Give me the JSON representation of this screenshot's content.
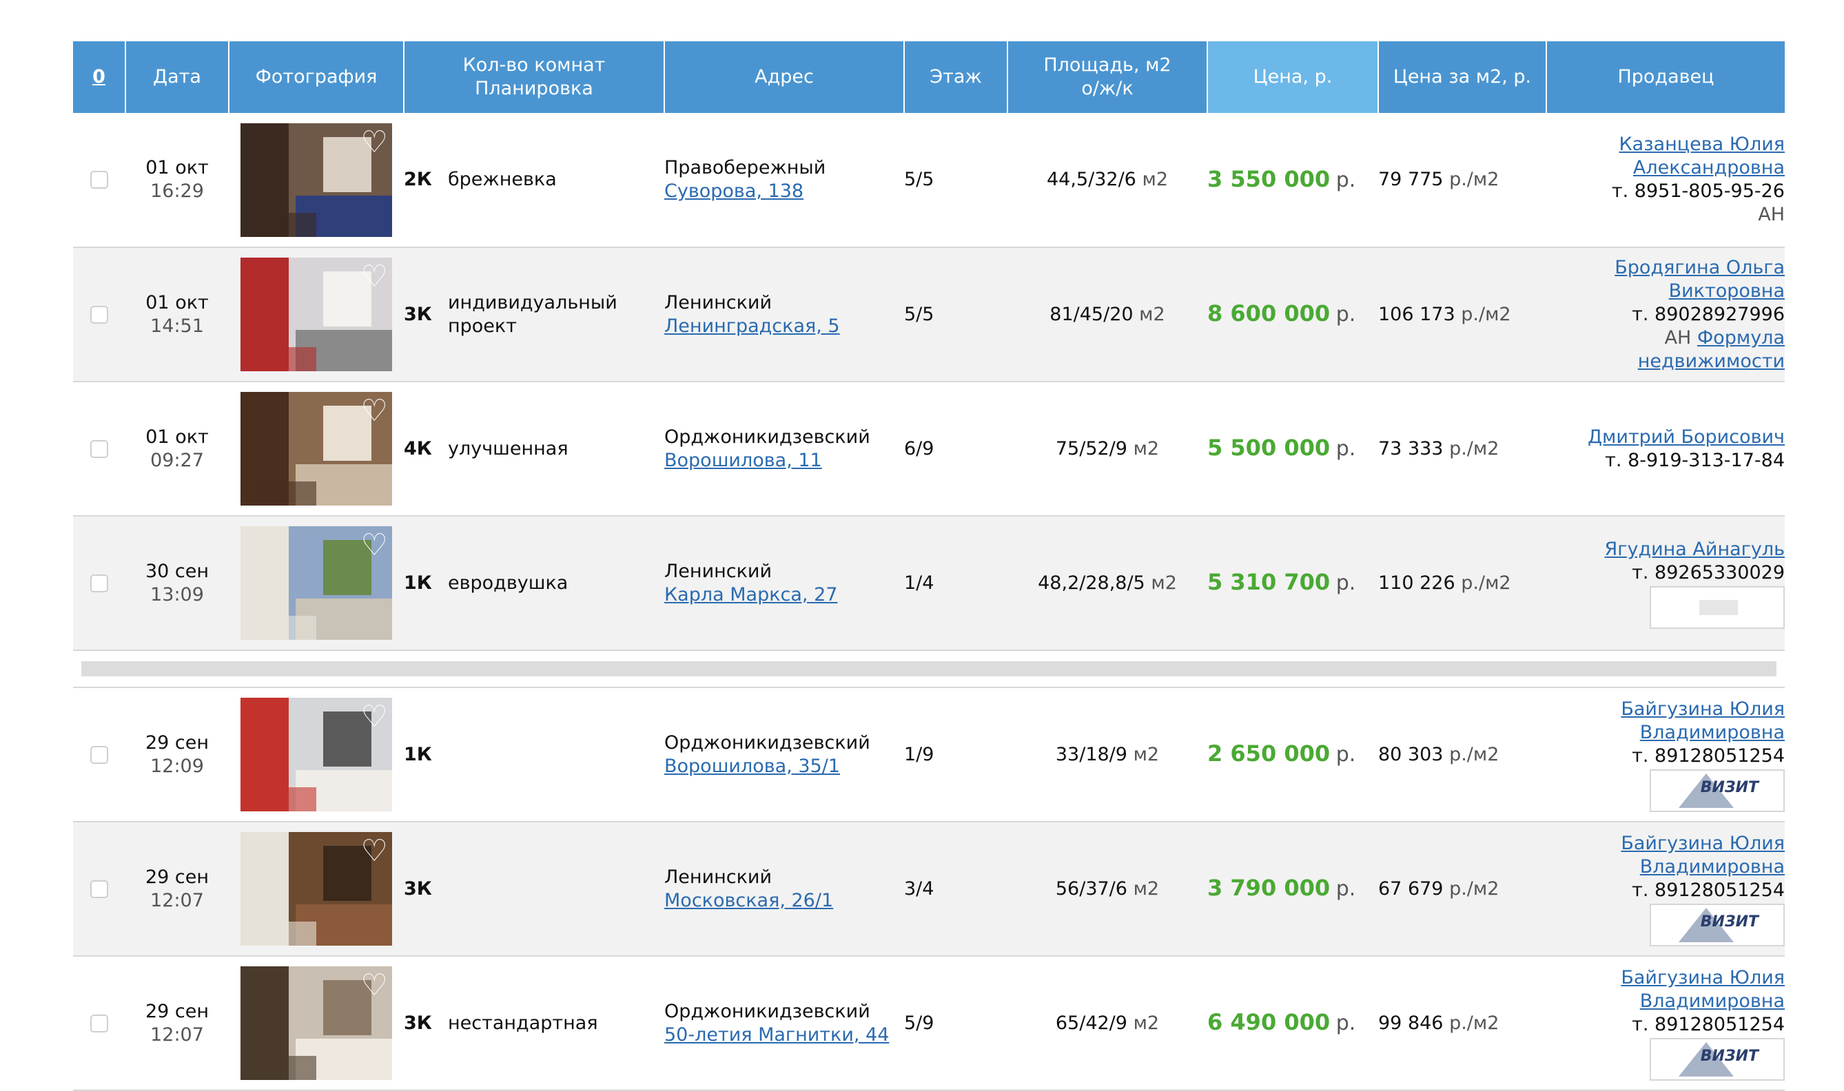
{
  "header": {
    "sort_label": "0",
    "date": "Дата",
    "photo": "Фотография",
    "rooms_line1": "Кол-во комнат",
    "rooms_line2": "Планировка",
    "address": "Адрес",
    "floor": "Этаж",
    "area_line1": "Площадь, м2",
    "area_line2": "о/ж/к",
    "price": "Цена, р.",
    "price_per_m2": "Цена за м2, р.",
    "seller": "Продавец"
  },
  "price_currency": "р.",
  "ppm_unit": "р./м2",
  "area_unit": "м2",
  "listings": [
    {
      "date": "01 окт",
      "time": "16:29",
      "rooms": "2К",
      "layout": "брежневка",
      "district": "Правобережный",
      "street": "Суворова, 138",
      "floor": "5/5",
      "area": "44,5/32/6",
      "price": "3 550 000",
      "ppm": "79 775",
      "seller_name": "Казанцева Юлия Александровна",
      "phone": "т. 8951-805-95-26",
      "agency_prefix": "АН",
      "agency_link": ""
    },
    {
      "date": "01 окт",
      "time": "14:51",
      "rooms": "3К",
      "layout": "индивидуальный проект",
      "district": "Ленинский",
      "street": "Ленинградская, 5",
      "floor": "5/5",
      "area": "81/45/20",
      "price": "8 600 000",
      "ppm": "106 173",
      "seller_name": "Бродягина Ольга Викторовна",
      "phone": "т. 89028927996",
      "agency_prefix": "АН",
      "agency_link": "Формула недвижимости"
    },
    {
      "date": "01 окт",
      "time": "09:27",
      "rooms": "4К",
      "layout": "улучшенная",
      "district": "Орджоникидзевский",
      "street": "Ворошилова, 11",
      "floor": "6/9",
      "area": "75/52/9",
      "price": "5 500 000",
      "ppm": "73 333",
      "seller_name": "Дмитрий Борисович",
      "phone": "т. 8-919-313-17-84",
      "agency_prefix": "",
      "agency_link": ""
    },
    {
      "date": "30 сен",
      "time": "13:09",
      "rooms": "1К",
      "layout": "евродвушка",
      "district": "Ленинский",
      "street": "Карла Маркса, 27",
      "floor": "1/4",
      "area": "48,2/28,8/5",
      "price": "5 310 700",
      "ppm": "110 226",
      "seller_name": "Ягудина Айнагуль",
      "phone": "т. 89265330029",
      "agency_prefix": "",
      "agency_link": ""
    },
    {
      "date": "29 сен",
      "time": "12:09",
      "rooms": "1К",
      "layout": "",
      "district": "Орджоникидзевский",
      "street": "Ворошилова, 35/1",
      "floor": "1/9",
      "area": "33/18/9",
      "price": "2 650 000",
      "ppm": "80 303",
      "seller_name": "Байгузина Юлия Владимировна",
      "phone": "т. 89128051254",
      "agency_prefix": "",
      "agency_link": "",
      "logo_text": "ВИЗИТ"
    },
    {
      "date": "29 сен",
      "time": "12:07",
      "rooms": "3К",
      "layout": "",
      "district": "Ленинский",
      "street": "Московская, 26/1",
      "floor": "3/4",
      "area": "56/37/6",
      "price": "3 790 000",
      "ppm": "67 679",
      "seller_name": "Байгузина Юлия Владимировна",
      "phone": "т. 89128051254",
      "agency_prefix": "",
      "agency_link": "",
      "logo_text": "ВИЗИТ"
    },
    {
      "date": "29 сен",
      "time": "12:07",
      "rooms": "3К",
      "layout": "нестандартная",
      "district": "Орджоникидзевский",
      "street": "50-летия Магнитки, 44",
      "floor": "5/9",
      "area": "65/42/9",
      "price": "6 490 000",
      "ppm": "99 846",
      "seller_name": "Байгузина Юлия Владимировна",
      "phone": "т. 89128051254",
      "agency_prefix": "",
      "agency_link": "",
      "logo_text": "ВИЗИТ"
    }
  ]
}
